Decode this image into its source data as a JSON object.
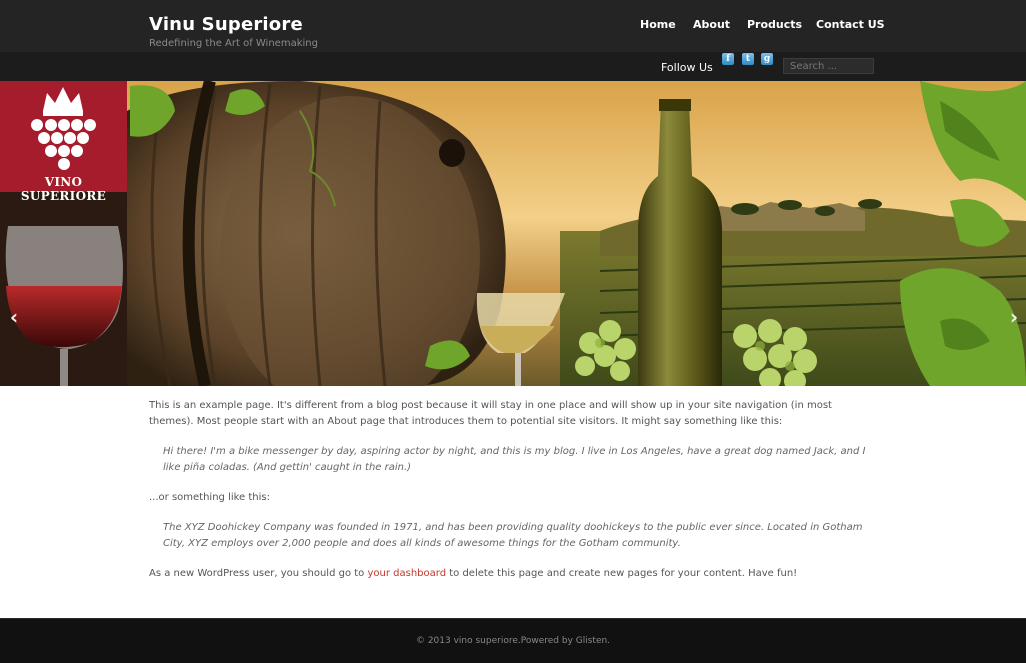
{
  "site": {
    "title": "Vinu Superiore",
    "tagline": "Redefining the Art of Winemaking"
  },
  "nav": {
    "items": [
      {
        "label": "Home"
      },
      {
        "label": "About"
      },
      {
        "label": "Products"
      },
      {
        "label": "Contact US"
      }
    ]
  },
  "subbar": {
    "follow_label": "Follow Us",
    "social": [
      {
        "icon": "facebook-icon",
        "glyph": "f"
      },
      {
        "icon": "twitter-icon",
        "glyph": "t"
      },
      {
        "icon": "google-icon",
        "glyph": "g"
      }
    ],
    "search_placeholder": "Search ..."
  },
  "slider": {
    "logo_text": "VINO SUPERIORE",
    "prev_glyph": "‹",
    "next_glyph": "›"
  },
  "content": {
    "intro": "This is an example page. It's different from a blog post because it will stay in one place and will show up in your site navigation (in most themes). Most people start with an About page that introduces them to potential site visitors. It might say something like this:",
    "quote1": "Hi there! I'm a bike messenger by day, aspiring actor by night, and this is my blog. I live in Los Angeles, have a great dog named Jack, and I like piña coladas. (And gettin' caught in the rain.)",
    "middle": "...or something like this:",
    "quote2": "The XYZ Doohickey Company was founded in 1971, and has been providing quality doohickeys to the public ever since. Located in Gotham City, XYZ employs over 2,000 people and does all kinds of awesome things for the Gotham community.",
    "outro_before": "As a new WordPress user, you should go to ",
    "outro_link": "your dashboard",
    "outro_after": " to delete this page and create new pages for your content. Have fun!"
  },
  "footer": {
    "text": "© 2013 vino superiore.Powered by Glisten."
  },
  "colors": {
    "header_bg": "#242424",
    "subbar_bg": "#1c1c1c",
    "logo_red": "#a51c2c",
    "link_red": "#c0392b",
    "footer_bg": "#111111"
  }
}
